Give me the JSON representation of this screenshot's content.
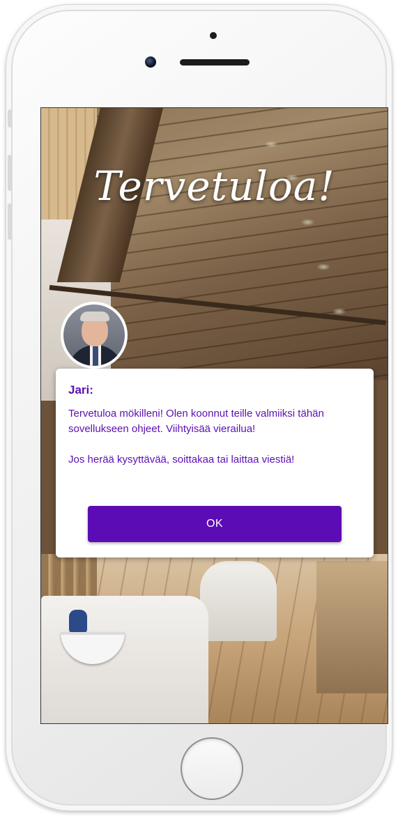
{
  "welcome": {
    "title": "Tervetuloa!"
  },
  "dialog": {
    "name": "Jari:",
    "message_1": "Tervetuloa mökilleni! Olen koonnut teille valmiiksi tähän sovellukseen ohjeet. Viihtyisää vierailua!",
    "message_2": "Jos herää kysyttävää, soittakaa tai laittaa viestiä!",
    "ok_label": "OK"
  },
  "colors": {
    "accent": "#5c0cb4",
    "text_accent": "#5b0fb3"
  },
  "icons": {
    "avatar": "host-portrait",
    "home": "home-button-icon"
  }
}
